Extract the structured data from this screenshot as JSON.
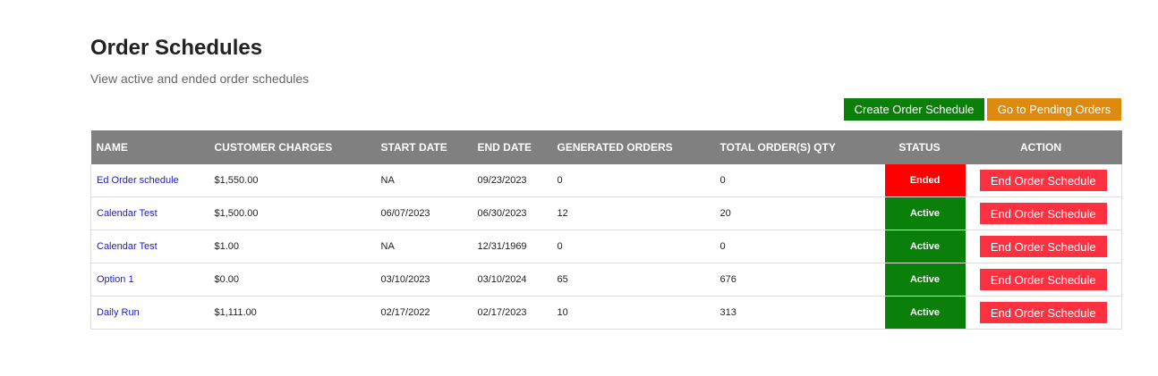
{
  "header": {
    "title": "Order Schedules",
    "subtitle": "View active and ended order schedules"
  },
  "toolbar": {
    "create_label": "Create Order Schedule",
    "pending_label": "Go to Pending Orders"
  },
  "table": {
    "columns": [
      "NAME",
      "CUSTOMER CHARGES",
      "START DATE",
      "END DATE",
      "GENERATED ORDERS",
      "TOTAL ORDER(S) QTY",
      "STATUS",
      "ACTION"
    ],
    "action_label": "End Order Schedule",
    "rows": [
      {
        "name": "Ed Order schedule",
        "charges": "$1,550.00",
        "start": "NA",
        "end": "09/23/2023",
        "generated": "0",
        "qty": "0",
        "status": "Ended"
      },
      {
        "name": "Calendar Test",
        "charges": "$1,500.00",
        "start": "06/07/2023",
        "end": "06/30/2023",
        "generated": "12",
        "qty": "20",
        "status": "Active"
      },
      {
        "name": "Calendar Test",
        "charges": "$1.00",
        "start": "NA",
        "end": "12/31/1969",
        "generated": "0",
        "qty": "0",
        "status": "Active"
      },
      {
        "name": "Option 1",
        "charges": "$0.00",
        "start": "03/10/2023",
        "end": "03/10/2024",
        "generated": "65",
        "qty": "676",
        "status": "Active"
      },
      {
        "name": "Daily Run",
        "charges": "$1,111.00",
        "start": "02/17/2022",
        "end": "02/17/2023",
        "generated": "10",
        "qty": "313",
        "status": "Active"
      }
    ]
  },
  "colors": {
    "header_bg": "#808080",
    "active": "#0a7f0a",
    "ended": "#ff0000",
    "end_button": "#ff3040",
    "create_button": "#0a7f0a",
    "pending_button": "#de8a0e",
    "link": "#1a1acc"
  }
}
